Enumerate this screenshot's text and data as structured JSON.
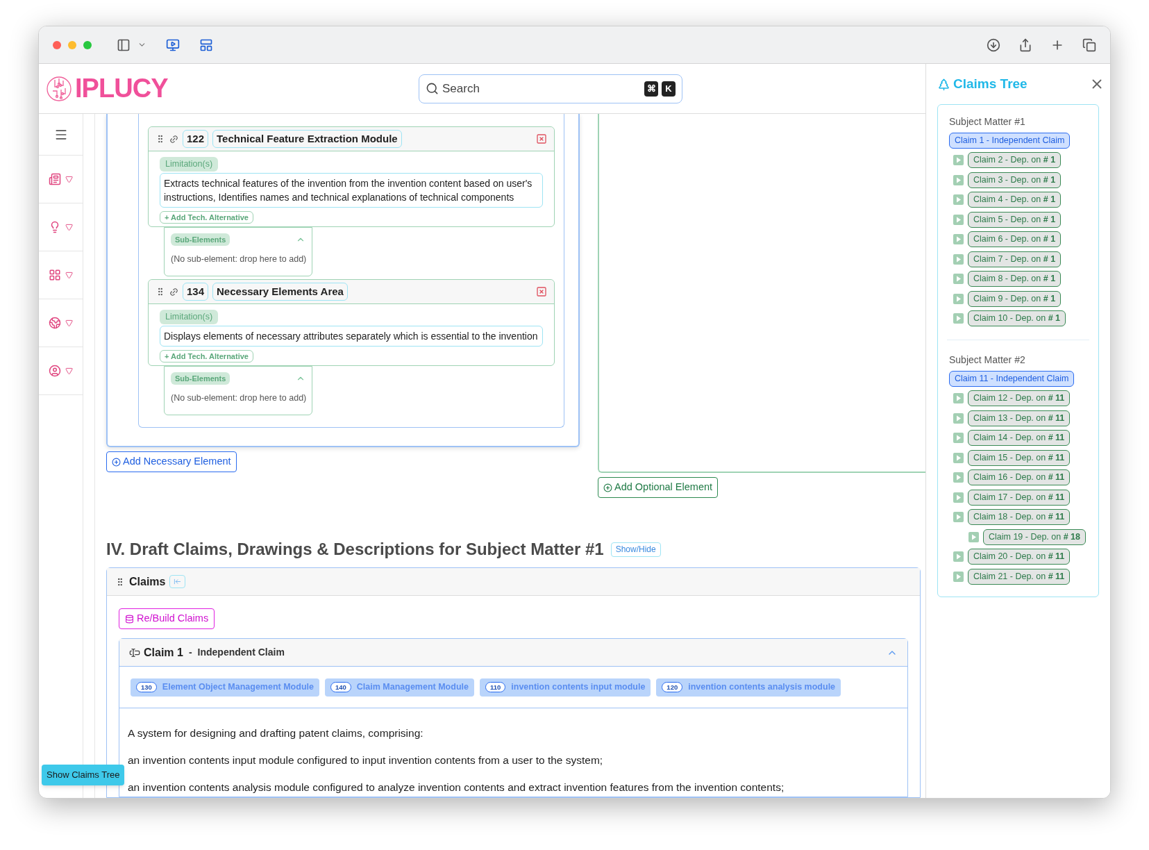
{
  "header": {
    "logo": "IPLUCY",
    "search": {
      "placeholder": "Search",
      "shortcut_keys": [
        "⌘",
        "K"
      ]
    }
  },
  "necessary_elements": {
    "elements": [
      {
        "number": "122",
        "name": "Technical Feature Extraction Module",
        "limitation_label": "Limitation(s)",
        "limitation": "Extracts technical features of the invention from the invention content based on user's instructions, Identifies names and technical explanations of technical components",
        "add_alternative": "+ Add Tech. Alternative",
        "sub_elements": {
          "label": "Sub-Elements",
          "expanded": true,
          "empty_text": "(No sub-element: drop here to add)"
        }
      },
      {
        "number": "134",
        "name": "Necessary Elements Area",
        "limitation_label": "Limitation(s)",
        "limitation": "Displays elements of necessary attributes separately which is essential to the invention",
        "add_alternative": "+ Add Tech. Alternative",
        "sub_elements": {
          "label": "Sub-Elements",
          "expanded": true,
          "empty_text": "(No sub-element: drop here to add)"
        }
      }
    ],
    "add_button": "Add Necessary Element"
  },
  "optional_elements": {
    "add_button": "Add Optional Element"
  },
  "draft_section": {
    "title": "IV. Draft Claims, Drawings & Descriptions for Subject Matter #1",
    "toggle": "Show/Hide",
    "claims_panel": {
      "title": "Claims",
      "rebuild_button": "Re/Build Claims",
      "claims": [
        {
          "title": "Claim 1",
          "separator": "-",
          "type": "Independent Claim",
          "expanded": true,
          "elements": [
            {
              "number": "130",
              "name": "Element Object Management Module"
            },
            {
              "number": "140",
              "name": "Claim Management Module"
            },
            {
              "number": "110",
              "name": "invention contents input module"
            },
            {
              "number": "120",
              "name": "invention contents analysis module"
            }
          ],
          "paragraphs": [
            "A system for designing and drafting patent claims, comprising:",
            "an invention contents input module configured to input invention contents from a user to the system;",
            "an invention contents analysis module configured to analyze invention contents and extract invention features from the invention contents;"
          ]
        }
      ]
    }
  },
  "show_tree_button": "Show Claims Tree",
  "claims_tree": {
    "title": "Claims Tree",
    "groups": [
      {
        "title": "Subject Matter #1",
        "claims": [
          {
            "label": "Claim 1 - Independent Claim",
            "kind": "independent",
            "children": [
              {
                "label": "Claim 2 - Dep. on **# 1**",
                "kind": "dependent"
              },
              {
                "label": "Claim 3 - Dep. on **# 1**",
                "kind": "dependent"
              },
              {
                "label": "Claim 4 - Dep. on **# 1**",
                "kind": "dependent"
              },
              {
                "label": "Claim 5 - Dep. on **# 1**",
                "kind": "dependent"
              },
              {
                "label": "Claim 6 - Dep. on **# 1**",
                "kind": "dependent"
              },
              {
                "label": "Claim 7 - Dep. on **# 1**",
                "kind": "dependent"
              },
              {
                "label": "Claim 8 - Dep. on **# 1**",
                "kind": "dependent"
              },
              {
                "label": "Claim 9 - Dep. on **# 1**",
                "kind": "dependent"
              },
              {
                "label": "Claim 10 - Dep. on **# 1**",
                "kind": "dependent"
              }
            ]
          }
        ]
      },
      {
        "title": "Subject Matter #2",
        "claims": [
          {
            "label": "Claim 11 - Independent Claim",
            "kind": "independent",
            "children": [
              {
                "label": "Claim 12 - Dep. on **# 11**",
                "kind": "dependent"
              },
              {
                "label": "Claim 13 - Dep. on **# 11**",
                "kind": "dependent"
              },
              {
                "label": "Claim 14 - Dep. on **# 11**",
                "kind": "dependent"
              },
              {
                "label": "Claim 15 - Dep. on **# 11**",
                "kind": "dependent"
              },
              {
                "label": "Claim 16 - Dep. on **# 11**",
                "kind": "dependent"
              },
              {
                "label": "Claim 17 - Dep. on **# 11**",
                "kind": "dependent"
              },
              {
                "label": "Claim 18 - Dep. on **# 11**",
                "kind": "dependent",
                "children": [
                  {
                    "label": "Claim 19 - Dep. on **# 18**",
                    "kind": "dependent"
                  }
                ]
              },
              {
                "label": "Claim 20 - Dep. on **# 11**",
                "kind": "dependent"
              },
              {
                "label": "Claim 21 - Dep. on **# 11**",
                "kind": "dependent"
              }
            ]
          }
        ]
      }
    ]
  }
}
